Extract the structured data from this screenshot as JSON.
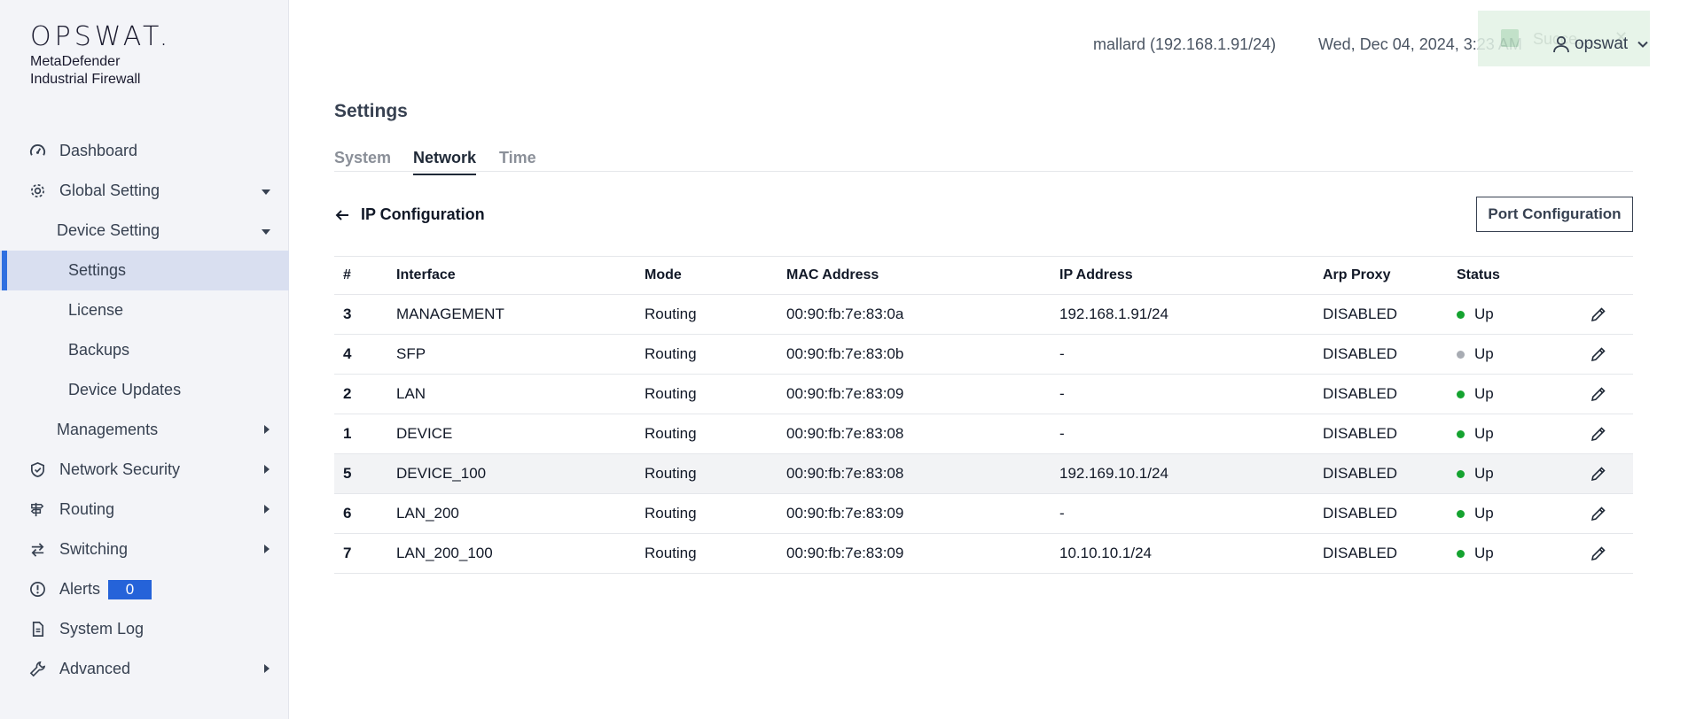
{
  "brand": {
    "logo": "OPSWAT.",
    "product_line1": "MetaDefender",
    "product_line2": "Industrial Firewall"
  },
  "sidebar": {
    "items": [
      {
        "label": "Dashboard",
        "icon": "dashboard-icon"
      },
      {
        "label": "Global Setting",
        "icon": "gear-icon"
      },
      {
        "label": "Device Setting"
      },
      {
        "label": "Settings"
      },
      {
        "label": "License"
      },
      {
        "label": "Backups"
      },
      {
        "label": "Device Updates"
      },
      {
        "label": "Managements"
      },
      {
        "label": "Network Security",
        "icon": "shield-icon"
      },
      {
        "label": "Routing",
        "icon": "signpost-icon"
      },
      {
        "label": "Switching",
        "icon": "switch-arrows-icon"
      },
      {
        "label": "Alerts",
        "icon": "alert-icon",
        "badge": "0"
      },
      {
        "label": "System Log",
        "icon": "document-icon"
      },
      {
        "label": "Advanced",
        "icon": "wrench-icon"
      }
    ],
    "accent_color": "#2f6fe0",
    "badge_color": "#2563d9"
  },
  "header": {
    "host": "mallard (192.168.1.91/24)",
    "datetime": "Wed, Dec 04, 2024, 3:23 AM",
    "toast_text": "Succe...",
    "user": "opswat"
  },
  "main": {
    "title": "Settings",
    "tabs": [
      "System",
      "Network",
      "Time"
    ],
    "active_tab": "Network",
    "section_title": "IP Configuration",
    "port_button": "Port Configuration"
  },
  "table": {
    "headers": [
      "#",
      "Interface",
      "Mode",
      "MAC Address",
      "IP Address",
      "Arp Proxy",
      "Status"
    ],
    "rows": [
      {
        "num": "3",
        "iface": "MANAGEMENT",
        "mode": "Routing",
        "mac": "00:90:fb:7e:83:0a",
        "ip": "192.168.1.91/24",
        "arp": "DISABLED",
        "status": "Up",
        "status_color": "#15a330"
      },
      {
        "num": "4",
        "iface": "SFP",
        "mode": "Routing",
        "mac": "00:90:fb:7e:83:0b",
        "ip": "-",
        "arp": "DISABLED",
        "status": "Up",
        "status_color": "#a8acb3"
      },
      {
        "num": "2",
        "iface": "LAN",
        "mode": "Routing",
        "mac": "00:90:fb:7e:83:09",
        "ip": "-",
        "arp": "DISABLED",
        "status": "Up",
        "status_color": "#15a330"
      },
      {
        "num": "1",
        "iface": "DEVICE",
        "mode": "Routing",
        "mac": "00:90:fb:7e:83:08",
        "ip": "-",
        "arp": "DISABLED",
        "status": "Up",
        "status_color": "#15a330"
      },
      {
        "num": "5",
        "iface": "DEVICE_100",
        "mode": "Routing",
        "mac": "00:90:fb:7e:83:08",
        "ip": "192.169.10.1/24",
        "arp": "DISABLED",
        "status": "Up",
        "status_color": "#15a330"
      },
      {
        "num": "6",
        "iface": "LAN_200",
        "mode": "Routing",
        "mac": "00:90:fb:7e:83:09",
        "ip": "-",
        "arp": "DISABLED",
        "status": "Up",
        "status_color": "#15a330"
      },
      {
        "num": "7",
        "iface": "LAN_200_100",
        "mode": "Routing",
        "mac": "00:90:fb:7e:83:09",
        "ip": "10.10.10.1/24",
        "arp": "DISABLED",
        "status": "Up",
        "status_color": "#15a330"
      }
    ]
  }
}
